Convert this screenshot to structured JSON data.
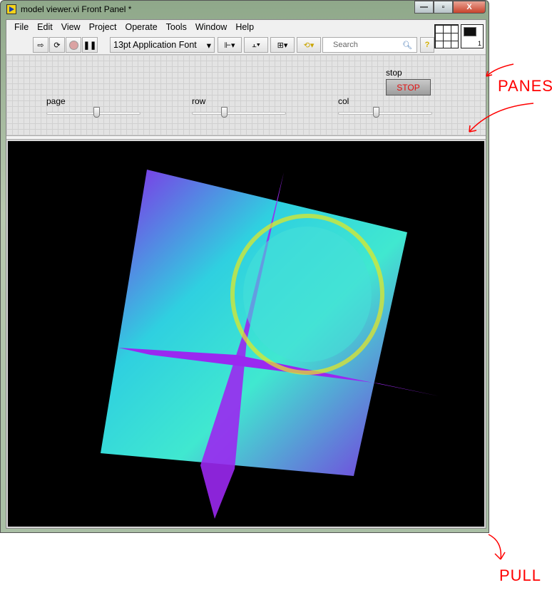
{
  "window": {
    "title": "model viewer.vi Front Panel *",
    "controls": [
      "minimize",
      "maximize",
      "close"
    ]
  },
  "menu": [
    "File",
    "Edit",
    "View",
    "Project",
    "Operate",
    "Tools",
    "Window",
    "Help"
  ],
  "toolbar": {
    "font": "13pt Application Font",
    "search_placeholder": "Search",
    "help": "?",
    "vi_icon_number": "1"
  },
  "controls": {
    "page": {
      "label": "page",
      "value_fraction": 0.53
    },
    "row": {
      "label": "row",
      "value_fraction": 0.34
    },
    "col": {
      "label": "col",
      "value_fraction": 0.4
    },
    "stop": {
      "label": "stop",
      "button": "STOP"
    }
  },
  "annotations": {
    "panes": "PANES",
    "pull": "PULL"
  },
  "colors": {
    "accent_annotation": "#ff0000",
    "stop_text": "#e21010",
    "display_bg": "#000000"
  }
}
